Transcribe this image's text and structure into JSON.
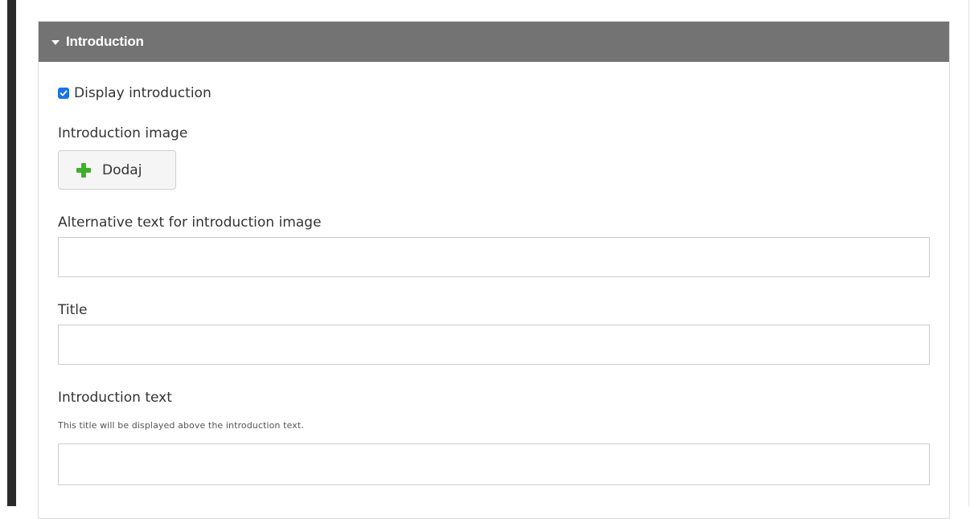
{
  "section": {
    "title": "Introduction",
    "display_checkbox": {
      "label": "Display introduction",
      "checked": true
    },
    "image_field": {
      "label": "Introduction image",
      "add_button_label": "Dodaj"
    },
    "alt_text_field": {
      "label": "Alternative text for introduction image",
      "value": "",
      "placeholder": ""
    },
    "title_field": {
      "label": "Title",
      "value": "",
      "placeholder": ""
    },
    "intro_text_field": {
      "label": "Introduction text",
      "help": "This title will be displayed above the introduction text.",
      "value": "",
      "placeholder": ""
    }
  },
  "colors": {
    "header_bg": "#737373",
    "checkbox": "#1a73e8",
    "plus_icon": "#3fae29"
  },
  "icons": {
    "header_toggle": "caret-down-icon",
    "checkbox": "checkmark-icon",
    "add": "plus-icon"
  }
}
